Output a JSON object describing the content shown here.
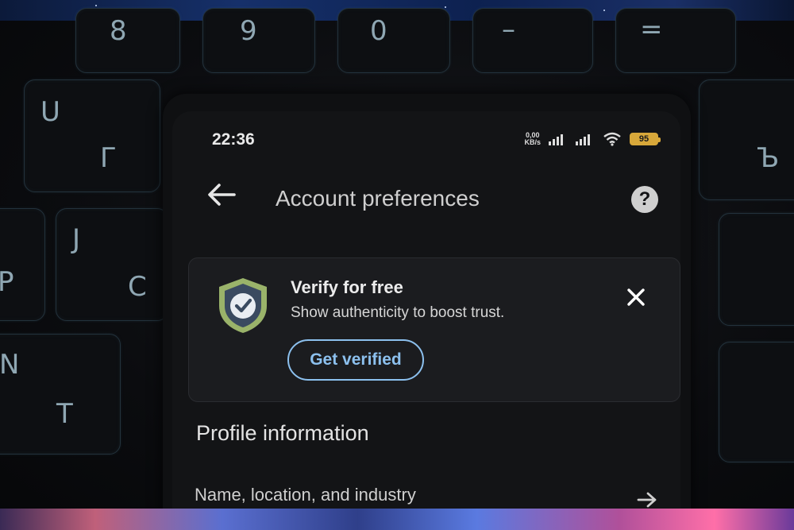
{
  "status_bar": {
    "time": "22:36",
    "net_speed_value": "0,00",
    "net_speed_unit": "KB/s",
    "battery": "95",
    "icons": [
      "signal-bars-icon",
      "signal-bars-icon",
      "wifi-icon",
      "battery-icon"
    ]
  },
  "header": {
    "title": "Account preferences",
    "back_icon": "arrow-left-icon",
    "help_icon": "question-mark-icon",
    "help_glyph": "?"
  },
  "verify_card": {
    "title": "Verify for free",
    "description": "Show authenticity to boost trust.",
    "button_label": "Get verified",
    "icon": "shield-check-icon",
    "close_icon": "close-icon"
  },
  "profile_section": {
    "title": "Profile information",
    "rows": [
      {
        "label": "Name, location, and industry",
        "icon": "arrow-right-icon"
      }
    ]
  },
  "keyboard": {
    "keys": [
      "8",
      "9",
      "0",
      "–",
      "=",
      "U",
      "Г",
      "J",
      "P",
      "C",
      "N",
      "T",
      "Ъ"
    ]
  },
  "colors": {
    "accent": "#8cc0ee",
    "screen_bg": "#131416",
    "card_bg": "#1b1c1f",
    "shield_fill": "#3a4a60",
    "shield_border": "#9ab36a",
    "battery": "#d8a83a"
  }
}
